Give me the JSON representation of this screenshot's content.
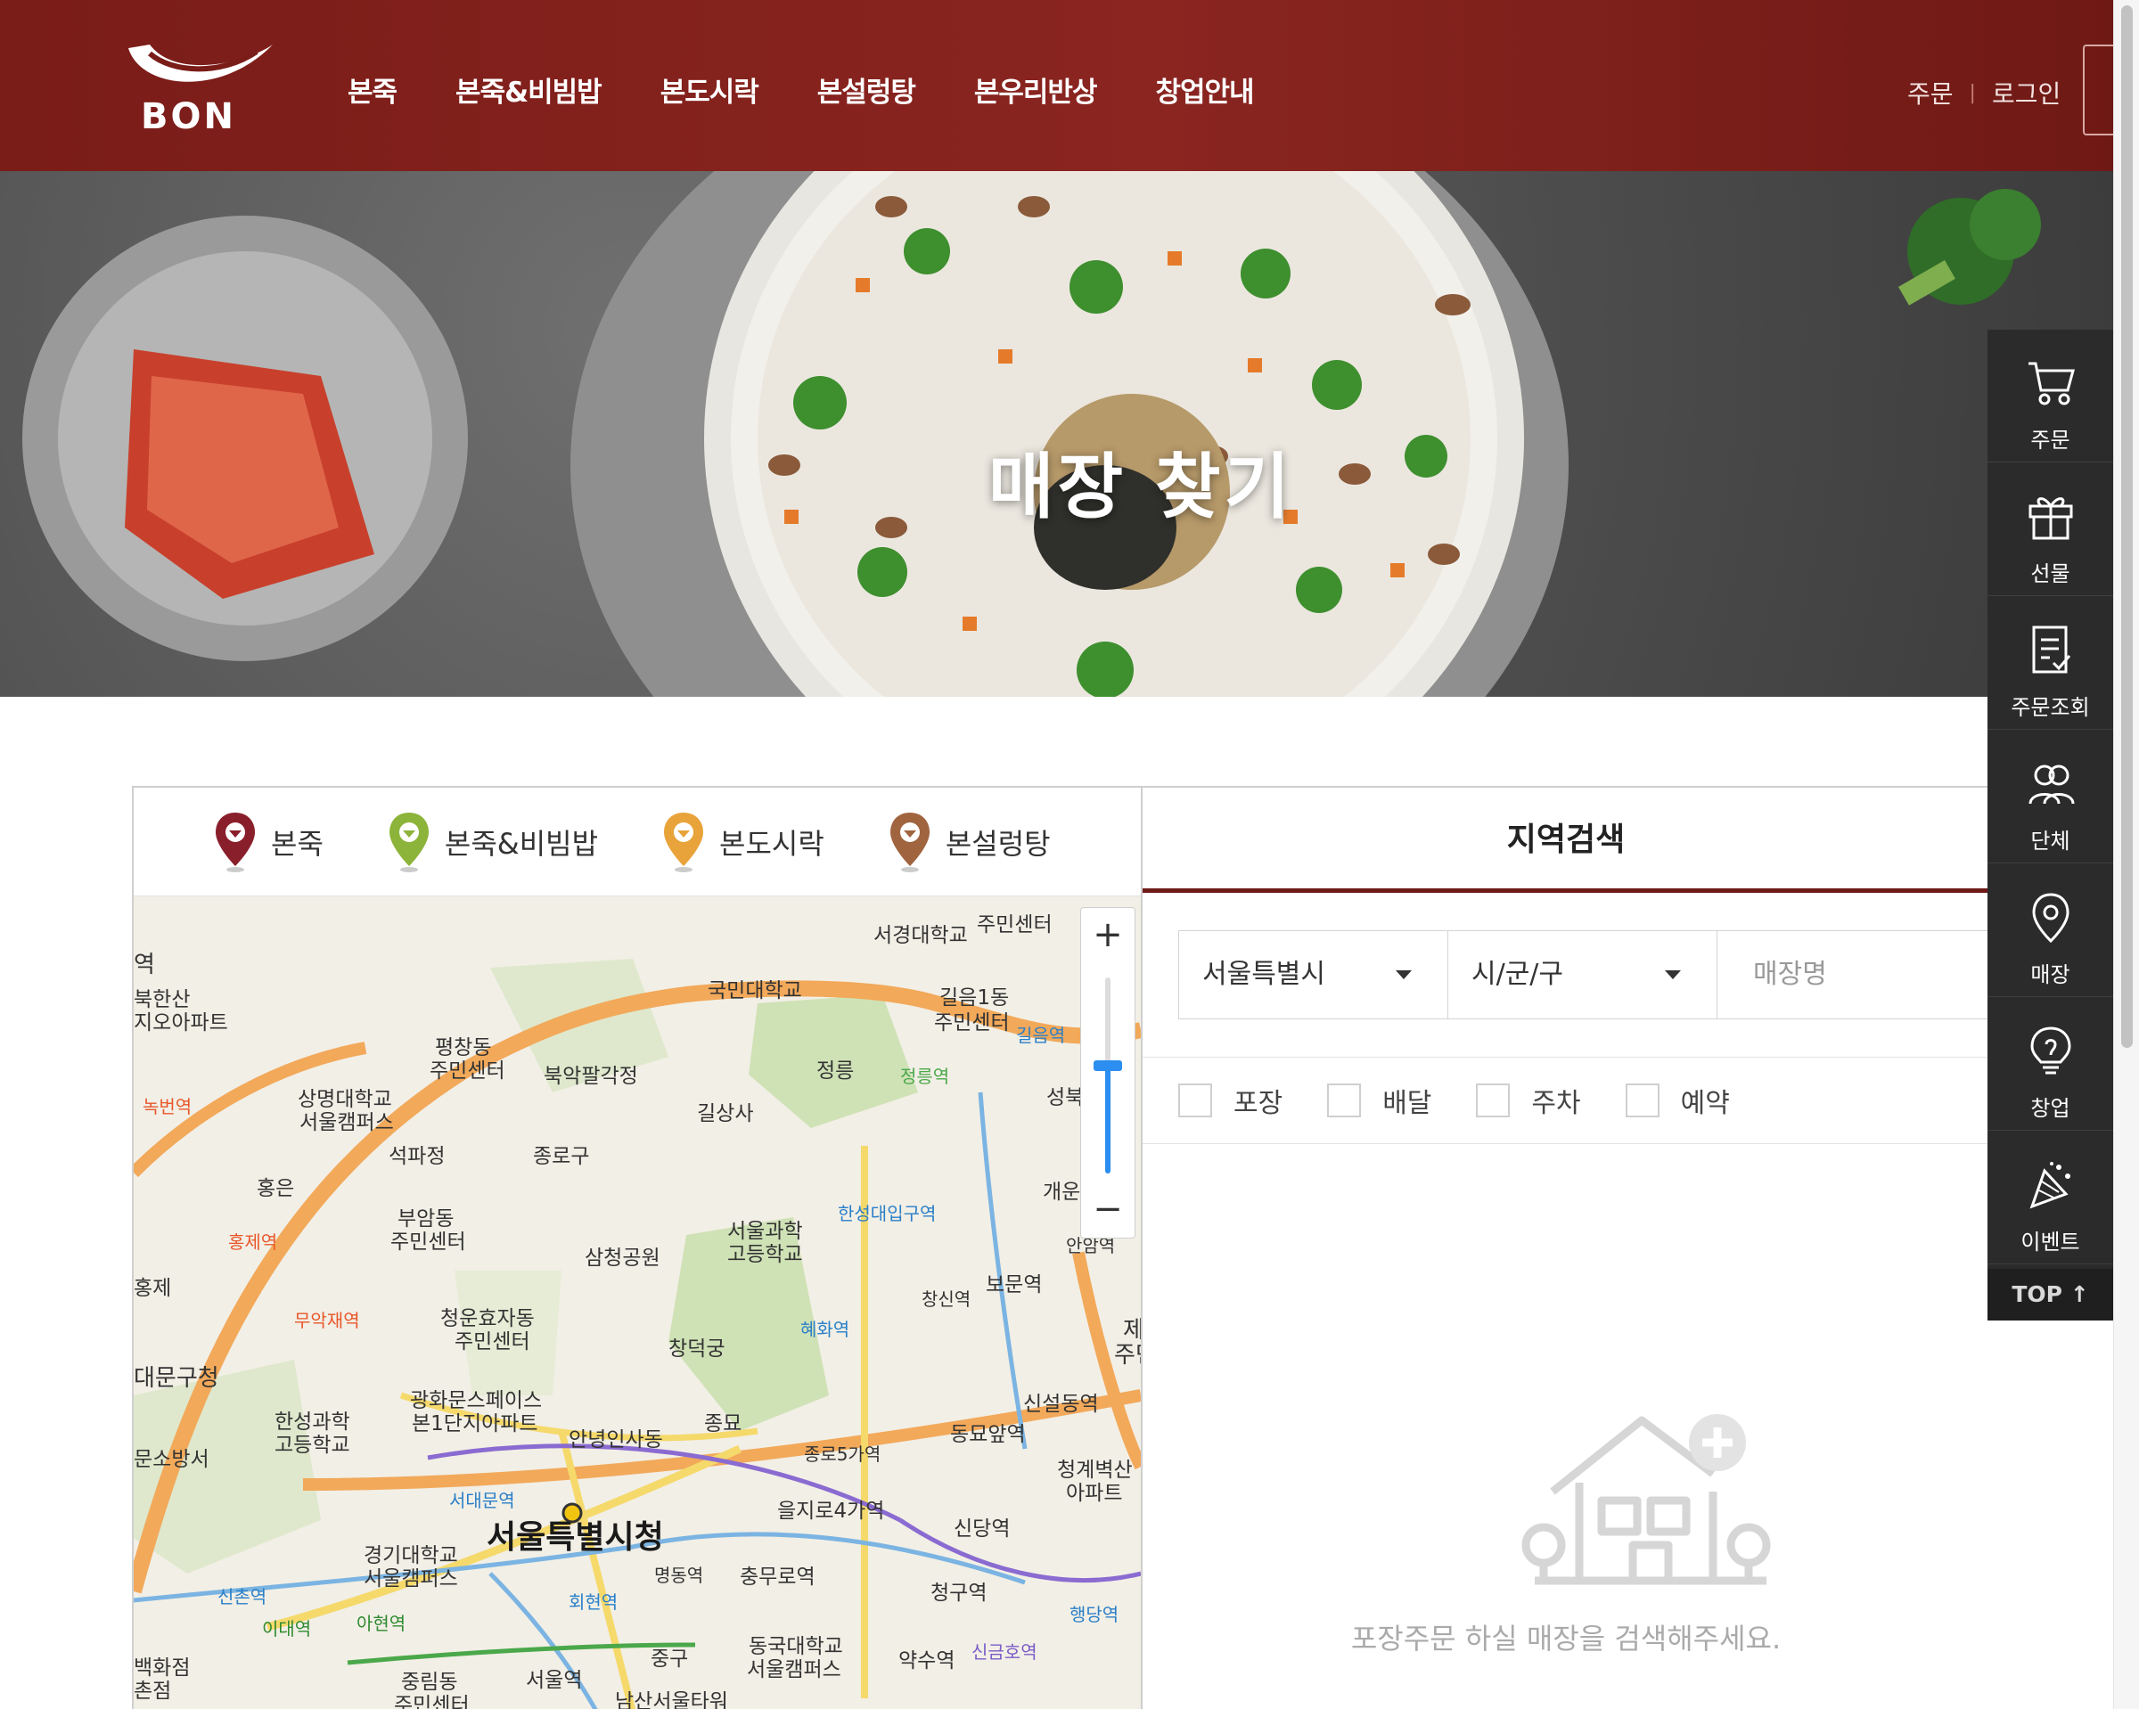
{
  "header": {
    "logo_text": "BON",
    "nav": [
      "본죽",
      "본죽&비빔밥",
      "본도시락",
      "본설렁탕",
      "본우리반상",
      "창업안내"
    ],
    "util_order": "주문",
    "util_login": "로그인"
  },
  "hero": {
    "title": "매장 찾기"
  },
  "map_panel": {
    "legend": [
      {
        "label": "본죽",
        "color": "#8a1f2c"
      },
      {
        "label": "본죽&비빔밥",
        "color": "#8db43a"
      },
      {
        "label": "본도시락",
        "color": "#e8a33a"
      },
      {
        "label": "본설렁탕",
        "color": "#a0643f"
      }
    ],
    "zoom_in": "+",
    "zoom_out": "−",
    "zoom_level_fraction": 0.55,
    "labels": {
      "l1": "서경대학교",
      "l2": "주민센터",
      "l3": "국민대학교",
      "l4": "길음1동",
      "l5": "주민센터",
      "l6": "북한산",
      "l7": "지오아파트",
      "l8": "평창동",
      "l9": "주민센터",
      "l10": "북악팔각정",
      "l11": "정릉",
      "l12": "상명대학교",
      "l13": "서울캠퍼스",
      "l14": "길상사",
      "l15": "성북",
      "l16": "종로구",
      "l17": "석파정",
      "l18": "홍은",
      "l19": "부암동",
      "l20": "주민센터",
      "l21": "개운",
      "l22": "서울과학",
      "l23": "고등학교",
      "l24": "홍제",
      "l25": "삼청공원",
      "l26": "보문역",
      "l27": "청운효자동",
      "l28": "주민센터",
      "l29": "창덕궁",
      "l30": "대문구청",
      "l31": "광화문스페이스",
      "l32": "본1단지아파트",
      "l33": "한성과학",
      "l34": "고등학교",
      "l35": "종묘",
      "l36": "신설동역",
      "l37": "안녕인사동",
      "l38": "동묘앞역",
      "l39": "문소방서",
      "l40": "종로5가역",
      "l41": "청계벽산",
      "l42": "아파트",
      "l43": "을지로4가역",
      "l44": "서울특별시청",
      "l45": "신당역",
      "l46": "경기대학교",
      "l47": "서울캠퍼스",
      "l48": "명동역",
      "l49": "충무로역",
      "l50": "청구역",
      "l51": "신촌역",
      "l52": "이대역",
      "l53": "아현역",
      "l54": "회현역",
      "l55": "중구",
      "l56": "동국대학교",
      "l57": "서울캠퍼스",
      "l58": "약수역",
      "l59": "신금호역",
      "l60": "백화점",
      "l61": "촌점",
      "l62": "중림동",
      "l63": "주민센터",
      "l64": "서울역",
      "l65": "남산서울타워",
      "l66": "행당역",
      "l67": "안암역",
      "l68": "한성대입구역",
      "l69": "혜화역",
      "l70": "창신역",
      "l71": "서대문역",
      "l72": "정릉역",
      "l73": "길음역",
      "l74": "녹번역",
      "l75": "홍제역",
      "l76": "무악재역",
      "l77": "제",
      "l78": "주민",
      "l79": "역"
    }
  },
  "search_panel": {
    "title": "지역검색",
    "city_select": "서울특별시",
    "district_select": "시/군/구",
    "store_placeholder": "매장명",
    "options": [
      "포장",
      "배달",
      "주차",
      "예약"
    ],
    "empty_message": "포장주문 하실 매장을 검색해주세요."
  },
  "quick_menu": {
    "items": [
      {
        "label": "주문",
        "icon": "cart-icon"
      },
      {
        "label": "선물",
        "icon": "gift-icon"
      },
      {
        "label": "주문조회",
        "icon": "order-check-icon"
      },
      {
        "label": "단체",
        "icon": "group-icon"
      },
      {
        "label": "매장",
        "icon": "location-icon"
      },
      {
        "label": "창업",
        "icon": "lightbulb-icon"
      },
      {
        "label": "이벤트",
        "icon": "party-icon"
      }
    ],
    "top": "TOP ↑"
  }
}
